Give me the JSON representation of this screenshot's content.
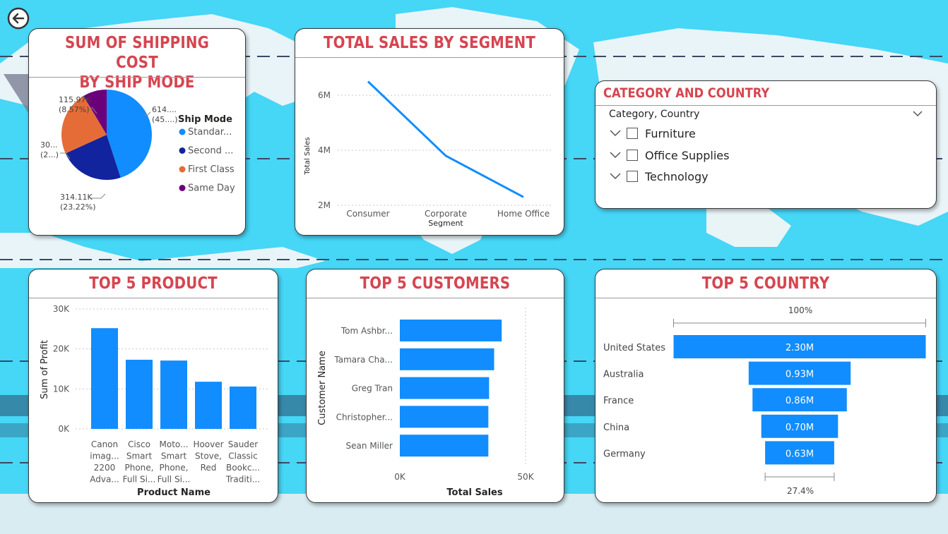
{
  "colors": {
    "accent_title": "#D64550",
    "bar_blue": "#118DFF",
    "navy": "#12239E",
    "orange": "#E66C37",
    "purple": "#6B007B",
    "bg_cyan": "#46D6F6"
  },
  "nav": {
    "back_icon": "back-arrow-icon"
  },
  "pie_card": {
    "title_line1": "SUM OF SHIPPING COST",
    "title_line2": "BY SHIP MODE",
    "legend_title": "Ship Mode",
    "legend": [
      "Standar...",
      "Second ...",
      "First Class",
      "Same Day"
    ],
    "labels": [
      {
        "v": "614....",
        "p": "(45....)"
      },
      {
        "v": "314.11K",
        "p": "(23.22%)"
      },
      {
        "v": "30...",
        "p": "(2...)"
      },
      {
        "v": "115.97K",
        "p": "(8.57%)"
      }
    ]
  },
  "segment_card": {
    "title": "TOTAL SALES BY SEGMENT",
    "ylabel": "Total Sales",
    "xlabel": "Segment",
    "yticks": [
      "6M",
      "4M",
      "2M"
    ]
  },
  "slicer": {
    "title": "CATEGORY AND COUNTRY",
    "header": "Category, Country",
    "items": [
      "Furniture",
      "Office Supplies",
      "Technology"
    ]
  },
  "product_card": {
    "title": "TOP 5 PRODUCT",
    "ylabel": "Sum of Profit",
    "xlabel": "Product Name",
    "yticks": [
      "30K",
      "20K",
      "10K",
      "0K"
    ],
    "xlabels": [
      [
        "Canon",
        "imag...",
        "2200",
        "Adva..."
      ],
      [
        "Cisco",
        "Smart",
        "Phone,",
        "Full Si..."
      ],
      [
        "Moto...",
        "Smart",
        "Phone,",
        "Full Si..."
      ],
      [
        "Hoover",
        "Stove,",
        "Red"
      ],
      [
        "Sauder",
        "Classic",
        "Bookc...",
        "Traditi..."
      ]
    ]
  },
  "customers_card": {
    "title": "TOP 5 CUSTOMERS",
    "ylabel": "Customer Name",
    "xlabel": "Total Sales",
    "xticks": [
      "0K",
      "50K"
    ]
  },
  "country_card": {
    "title": "TOP 5 COUNTRY",
    "top_pct": "100%",
    "bottom_pct": "27.4%"
  },
  "chart_data": [
    {
      "type": "pie",
      "title": "SUM OF SHIPPING COST BY SHIP MODE",
      "legend_title": "Ship Mode",
      "categories": [
        "Standard Class",
        "Second Class",
        "First Class",
        "Same Day"
      ],
      "values_pct": [
        45.0,
        23.22,
        23.21,
        8.57
      ],
      "labels": [
        "614....",
        "314.11K",
        "30...",
        "115.97K"
      ]
    },
    {
      "type": "line",
      "title": "TOTAL SALES BY SEGMENT",
      "xlabel": "Segment",
      "ylabel": "Total Sales",
      "categories": [
        "Consumer",
        "Corporate",
        "Home Office"
      ],
      "values": [
        6.5,
        3.8,
        2.3
      ],
      "ylim": [
        2,
        6
      ],
      "y_unit": "M"
    },
    {
      "type": "bar",
      "title": "TOP 5 PRODUCT",
      "xlabel": "Product Name",
      "ylabel": "Sum of Profit",
      "categories": [
        "Canon imag... 2200 Adva...",
        "Cisco Smart Phone, Full Si...",
        "Moto... Smart Phone, Full Si...",
        "Hoover Stove, Red",
        "Sauder Classic Bookc... Traditi..."
      ],
      "values": [
        25200,
        17300,
        17100,
        11800,
        10600
      ],
      "ylim": [
        0,
        30000
      ]
    },
    {
      "type": "bar",
      "orientation": "horizontal",
      "title": "TOP 5 CUSTOMERS",
      "xlabel": "Total Sales",
      "ylabel": "Customer Name",
      "categories": [
        "Tom Ashbr...",
        "Tamara Cha...",
        "Greg Tran",
        "Christopher...",
        "Sean Miller"
      ],
      "values": [
        40500,
        37500,
        35500,
        35200,
        35200
      ],
      "xlim": [
        0,
        50000
      ]
    },
    {
      "type": "bar",
      "orientation": "funnel",
      "title": "TOP 5 COUNTRY",
      "categories": [
        "United States",
        "Australia",
        "France",
        "China",
        "Germany"
      ],
      "values": [
        2.3,
        0.93,
        0.86,
        0.7,
        0.63
      ],
      "value_labels": [
        "2.30M",
        "0.93M",
        "0.86M",
        "0.70M",
        "0.63M"
      ],
      "unit": "M"
    }
  ]
}
